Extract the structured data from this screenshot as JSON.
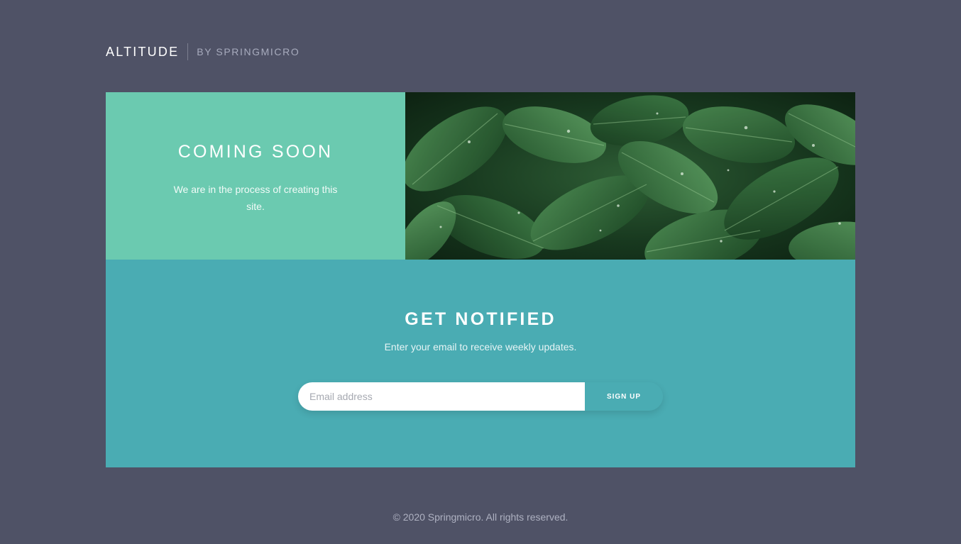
{
  "header": {
    "brand": "ALTITUDE",
    "byline": "BY SPRINGMICRO"
  },
  "hero": {
    "title": "COMING SOON",
    "text": "We are in the process of creating this site.",
    "image_icon": "leaves-photo"
  },
  "notify": {
    "title": "GET NOTIFIED",
    "text": "Enter your email to receive weekly updates.",
    "email_placeholder": "Email address",
    "email_value": "",
    "button_label": "SIGN UP"
  },
  "footer": {
    "copyright": "© 2020 Springmicro. All rights reserved."
  },
  "colors": {
    "background": "#4f5266",
    "hero_panel": "#6bcab0",
    "notify_panel": "#4aacb3",
    "leaves": "#2f6b3a"
  }
}
